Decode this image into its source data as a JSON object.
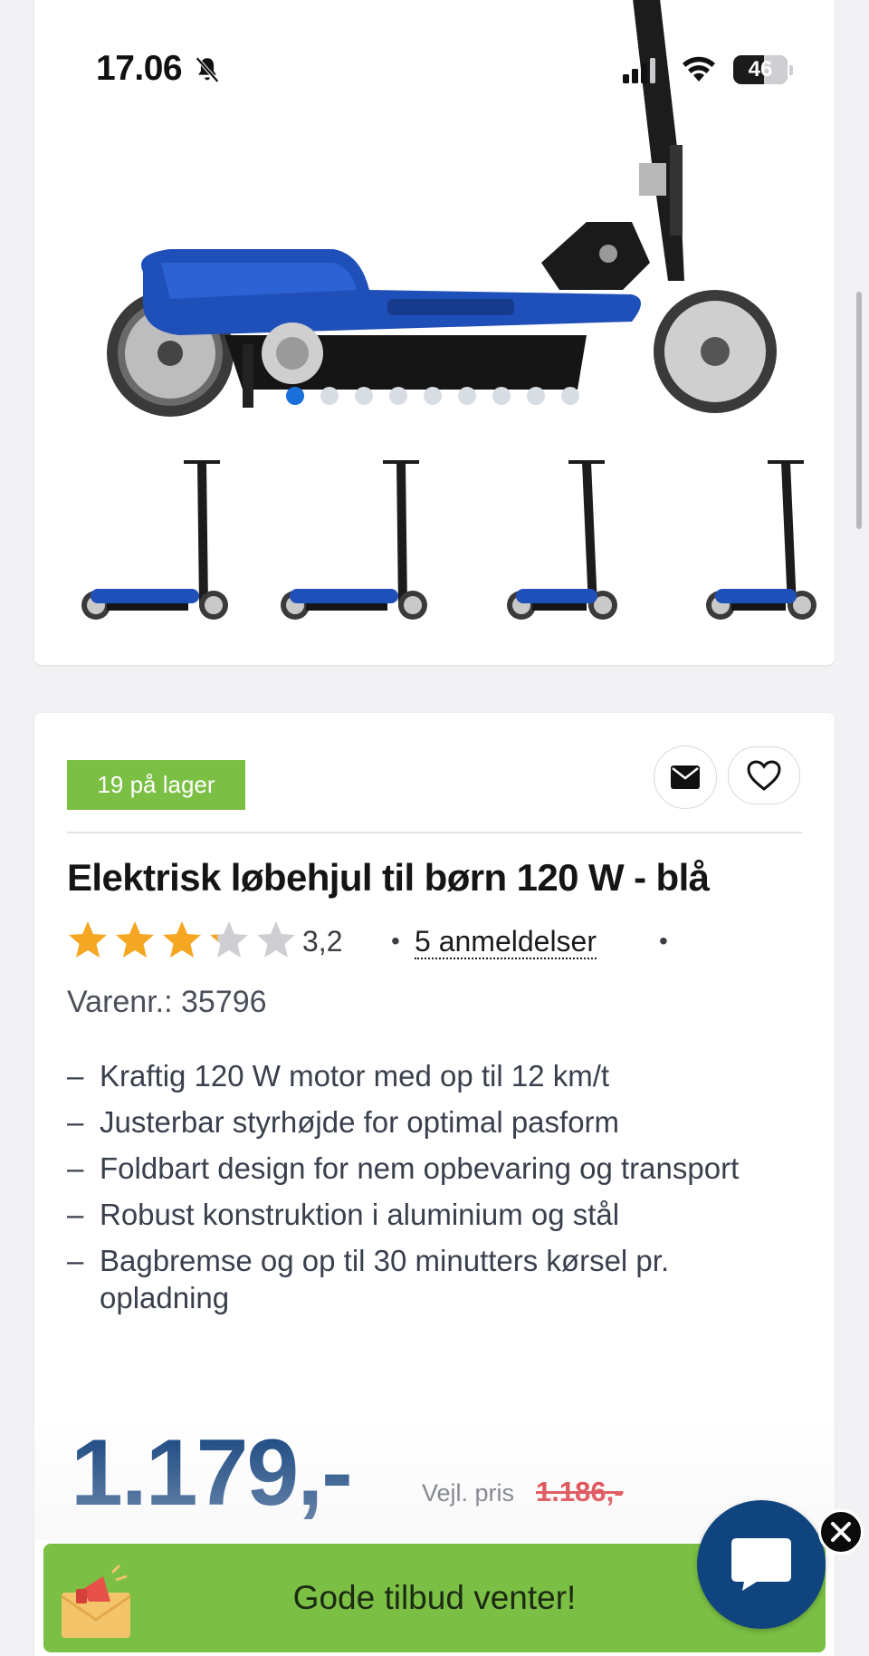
{
  "status_bar": {
    "time": "17.06",
    "battery": "46",
    "icons": [
      "bell-slash-icon",
      "signal-icon",
      "wifi-icon",
      "battery-icon"
    ]
  },
  "gallery": {
    "dot_count": 9,
    "active_dot": 0,
    "thumbnail_count": 4,
    "accent_color": "#1a6fd8"
  },
  "product": {
    "stock_badge": "19 på lager",
    "title": "Elektrisk løbehjul til børn 120 W - blå",
    "rating": {
      "stars_filled": 3.2,
      "stars_total": 5,
      "value": "3,2",
      "separator": "•",
      "reviews": "5 anmeldelser"
    },
    "sku_label": "Varenr.: ",
    "sku_value": "35796",
    "features": [
      "Kraftig 120 W motor med op til 12 km/t",
      "Justerbar styrhøjde for optimal pasform",
      "Foldbart design for nem opbevaring og transport",
      "Robust konstruktion i aluminium og stål",
      "Bagbremse og op til 30 minutters kørsel pr. opladning"
    ],
    "feature_bullet": "–",
    "price": "1.179,-",
    "rrp_label": "Vejl. pris",
    "rrp_value": "1.186,-"
  },
  "promo": {
    "text": "Gode tilbud venter!"
  },
  "colors": {
    "stock_green": "#7bbf44",
    "price_blue": "#0e3e7a",
    "rrp_red": "#d8232a",
    "star_gold": "#f5a623",
    "star_grey": "#cfcfd3",
    "chat_blue": "#0f447e"
  }
}
